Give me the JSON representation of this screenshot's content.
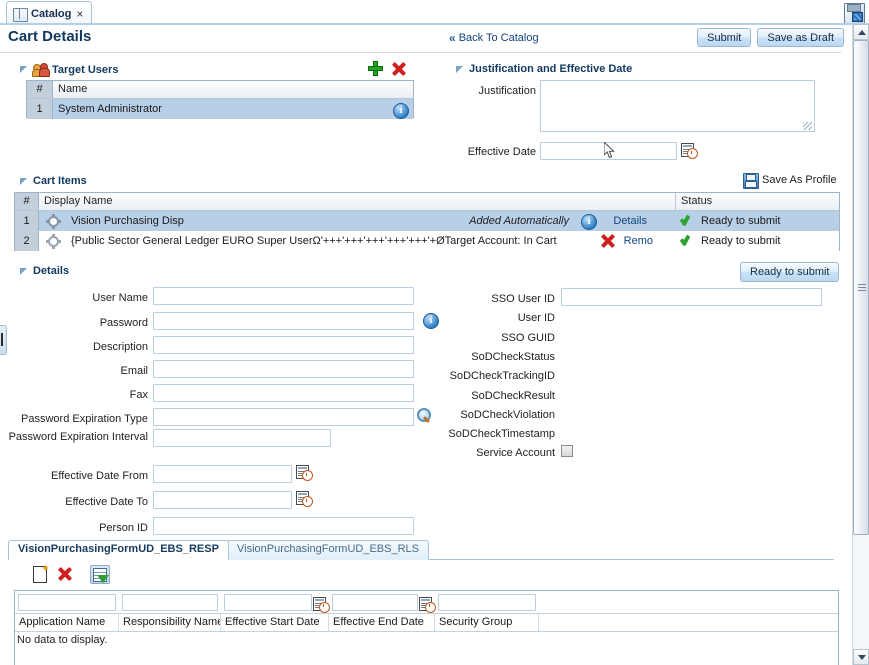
{
  "window": {
    "tab_label": "Catalog",
    "tab_close": "×",
    "save_icon_name": "save-disk-icon"
  },
  "header": {
    "page_title": "Cart Details",
    "back_link": "Back To Catalog",
    "submit_label": "Submit",
    "save_draft_label": "Save as Draft"
  },
  "target_users": {
    "section_title": "Target Users",
    "add_label": "Add",
    "remove_label": "Remove",
    "columns": [
      "#",
      "Name"
    ],
    "rows": [
      {
        "num": "1",
        "name": "System Administrator"
      }
    ]
  },
  "justification": {
    "section_title": "Justification and Effective Date",
    "justification_label": "Justification",
    "justification_value": "",
    "effective_date_label": "Effective Date",
    "effective_date_value": "",
    "effective_date_placeholder": ""
  },
  "cart_items": {
    "section_title": "Cart Items",
    "save_as_profile_label": "Save As Profile",
    "columns": [
      "#",
      "Display Name",
      "Status"
    ],
    "rows": [
      {
        "num": "1",
        "display_name": "Vision Purchasing Disp",
        "note": "Added Automatically",
        "action": "Details",
        "status": "Ready to submit",
        "selected": true
      },
      {
        "num": "2",
        "display_name": "{Public Sector General Ledger EURO Super UserΩ'+++'+++'+++'+++'+++'+ØTarget Account: In Cart",
        "note": "",
        "action": "Remo",
        "status": "Ready to submit",
        "selected": false
      }
    ]
  },
  "details": {
    "section_title": "Details",
    "ready_button": "Ready to submit",
    "left_fields": [
      {
        "label": "User Name",
        "value": ""
      },
      {
        "label": "Password",
        "value": ""
      },
      {
        "label": "Description",
        "value": ""
      },
      {
        "label": "Email",
        "value": ""
      },
      {
        "label": "Fax",
        "value": ""
      },
      {
        "label": "Password Expiration Type",
        "value": ""
      },
      {
        "label": "Password Expiration Interval",
        "value": ""
      },
      {
        "label": "Effective Date From",
        "value": ""
      },
      {
        "label": "Effective Date To",
        "value": ""
      },
      {
        "label": "Person ID",
        "value": ""
      }
    ],
    "right_fields": [
      {
        "label": "SSO User ID",
        "value": ""
      },
      {
        "label": "User ID",
        "value": ""
      },
      {
        "label": "SSO GUID",
        "value": ""
      },
      {
        "label": "SoDCheckStatus",
        "value": ""
      },
      {
        "label": "SoDCheckTrackingID",
        "value": ""
      },
      {
        "label": "SoDCheckResult",
        "value": ""
      },
      {
        "label": "SoDCheckViolation",
        "value": ""
      },
      {
        "label": "SoDCheckTimestamp",
        "value": ""
      },
      {
        "label": "Service Account",
        "value": ""
      }
    ]
  },
  "bottom": {
    "tabs": [
      {
        "label": "VisionPurchasingFormUD_EBS_RESP",
        "active": true
      },
      {
        "label": "VisionPurchasingFormUD_EBS_RLS",
        "active": false
      }
    ],
    "toolbar": {
      "new_label": "New",
      "delete_label": "Delete",
      "filter_label": "Query By Example"
    },
    "columns": [
      "Application Name",
      "Responsibility Name",
      "Effective Start Date",
      "Effective End Date",
      "Security Group"
    ],
    "filters": [
      "",
      "",
      "",
      "",
      ""
    ],
    "empty_text": "No data to display."
  }
}
